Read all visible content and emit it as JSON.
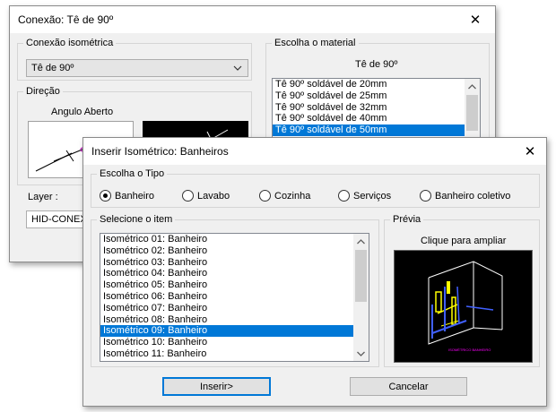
{
  "back_dialog": {
    "title": "Conexão: Tê de 90º",
    "close_glyph": "✕",
    "conexao_group_label": "Conexão isométrica",
    "conexao_selected": "Tê de 90º",
    "direcao_group_label": "Direção",
    "angulo_label": "Angulo Aberto",
    "layer_label": "Layer :",
    "layer_value": "HID-CONEXO",
    "material_group_label": "Escolha o material",
    "material_heading": "Tê de 90º",
    "material_items": [
      {
        "label": "Tê 90º soldável de 20mm",
        "selected": false
      },
      {
        "label": "Tê 90º soldável de 25mm",
        "selected": false
      },
      {
        "label": "Tê 90º soldável de 32mm",
        "selected": false
      },
      {
        "label": "Tê 90º soldável de 40mm",
        "selected": false
      },
      {
        "label": "Tê 90º soldável de 50mm",
        "selected": true
      }
    ]
  },
  "front_dialog": {
    "title": "Inserir Isométrico:  Banheiros",
    "close_glyph": "✕",
    "tipo_group_label": "Escolha o Tipo",
    "tipo_options": [
      {
        "label": "Banheiro",
        "checked": true
      },
      {
        "label": "Lavabo",
        "checked": false
      },
      {
        "label": "Cozinha",
        "checked": false
      },
      {
        "label": "Serviços",
        "checked": false
      },
      {
        "label": "Banheiro coletivo",
        "checked": false
      }
    ],
    "item_group_label": "Selecione o item",
    "items": [
      {
        "label": "Isométrico 01:  Banheiro",
        "selected": false
      },
      {
        "label": "Isométrico 02:  Banheiro",
        "selected": false
      },
      {
        "label": "Isométrico 03:  Banheiro",
        "selected": false
      },
      {
        "label": "Isométrico 04:  Banheiro",
        "selected": false
      },
      {
        "label": "Isométrico 05:  Banheiro",
        "selected": false
      },
      {
        "label": "Isométrico 06:  Banheiro",
        "selected": false
      },
      {
        "label": "Isométrico 07:  Banheiro",
        "selected": false
      },
      {
        "label": "Isométrico 08:  Banheiro",
        "selected": false
      },
      {
        "label": "Isométrico 09:  Banheiro",
        "selected": true
      },
      {
        "label": "Isométrico 10:  Banheiro",
        "selected": false
      },
      {
        "label": "Isométrico 11:  Banheiro",
        "selected": false
      }
    ],
    "previa_group_label": "Prévia",
    "previa_hint": "Clique para ampliar",
    "preview_caption": "ISOMÉTRICO BANHEIRO",
    "insert_button": "Inserir>",
    "cancel_button": "Cancelar"
  },
  "colors": {
    "selection": "#0078d7",
    "window_bg": "#f0f0f0",
    "preview_bg": "#000000"
  }
}
